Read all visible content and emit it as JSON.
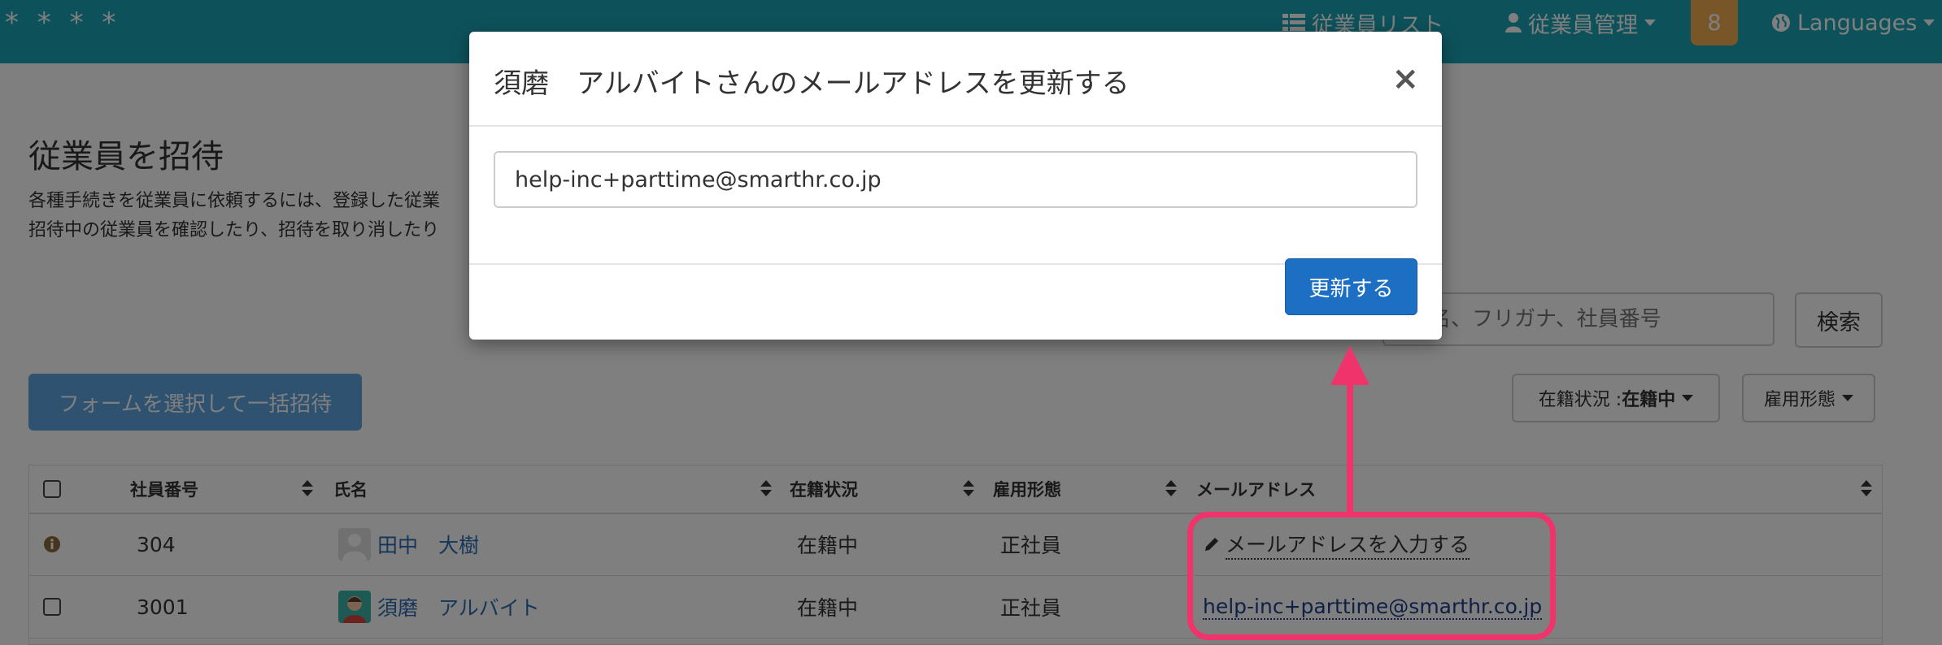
{
  "navbar": {
    "brand": "* * * *",
    "employee_list": "従業員リスト",
    "employee_manage": "従業員管理",
    "badge_count": "8",
    "languages": "Languages"
  },
  "page": {
    "title": "従業員を招待",
    "desc_line1": "各種手続きを従業員に依頼するには、登録した従業",
    "desc_line2": "招待中の従業員を確認したり、招待を取り消したり",
    "search_placeholder": "名、フリガナ、社員番号",
    "search_button": "検索",
    "bulk_invite_button": "フォームを選択して一括招待",
    "filter_status_label": "在籍状況 : ",
    "filter_status_value": "在籍中",
    "filter_employment": "雇用形態"
  },
  "table": {
    "headers": [
      "社員番号",
      "氏名",
      "在籍状況",
      "雇用形態",
      "メールアドレス"
    ],
    "rows": [
      {
        "id": "304",
        "name": "田中　大樹",
        "status": "在籍中",
        "type": "正社員",
        "email": "メールアドレスを入力する"
      },
      {
        "id": "3001",
        "name": "須磨　アルバイト",
        "status": "在籍中",
        "type": "正社員",
        "email": "help-inc+parttime@smarthr.co.jp"
      }
    ]
  },
  "modal": {
    "title": "須磨　アルバイトさんのメールアドレスを更新する",
    "close": "×",
    "email_value": "help-inc+parttime@smarthr.co.jp",
    "submit": "更新する"
  },
  "colors": {
    "navbar": "#1aa5b6",
    "primary_button": "#1c6fc3",
    "annotation": "#f0336a",
    "badge": "#f0ad4e"
  }
}
